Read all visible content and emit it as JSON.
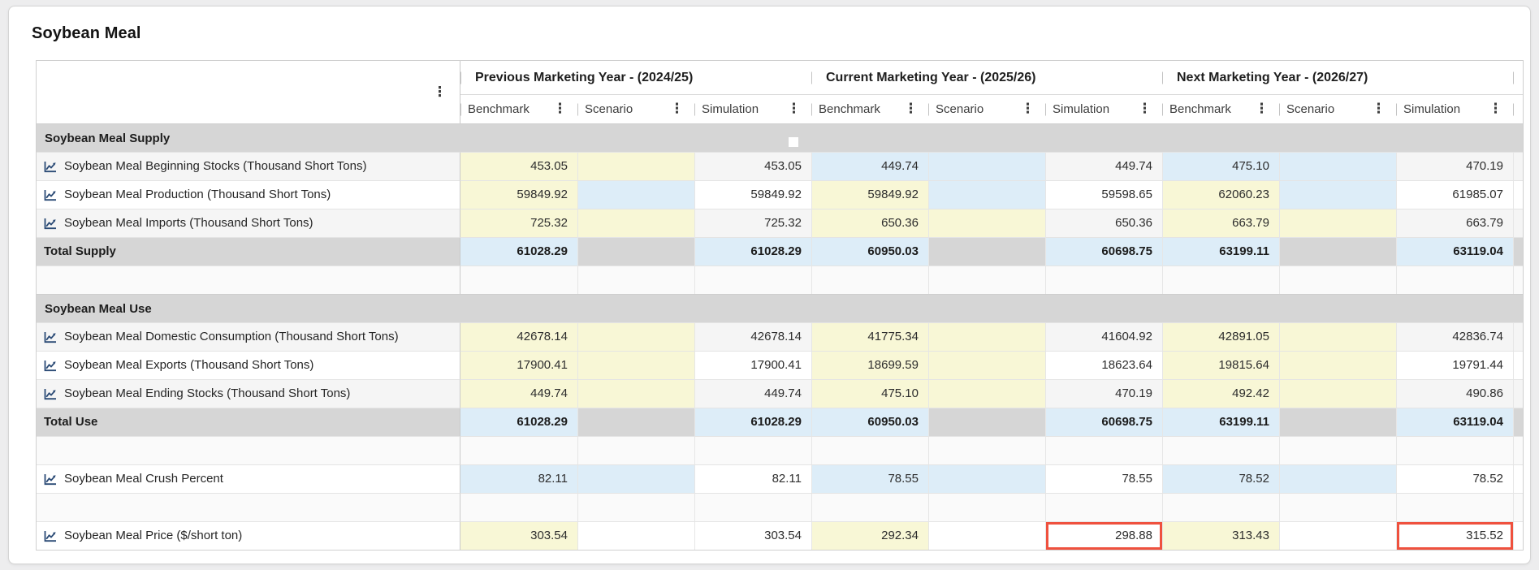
{
  "title": "Soybean Meal",
  "colors": {
    "editable_cell_yellow": "#f8f7d6",
    "linked_cell_blue": "#ddedf8",
    "section_gray": "#d6d6d6",
    "highlight_red": "#ef513e",
    "chart_icon_navy": "#2a4a75"
  },
  "icons": {
    "table_menu": "kebab-menu",
    "column_menu": "kebab-menu",
    "row_chart": "line-chart"
  },
  "table": {
    "year_groups": [
      {
        "label": "Previous Marketing Year - (2024/25)"
      },
      {
        "label": "Current Marketing Year - (2025/26)"
      },
      {
        "label": "Next Marketing Year - (2026/27)"
      }
    ],
    "sub_columns": [
      "Benchmark",
      "Scenario",
      "Simulation"
    ],
    "rows": [
      {
        "type": "section",
        "label": "Soybean Meal Supply"
      },
      {
        "type": "data",
        "striped": true,
        "icon": "line-chart",
        "label": "Soybean Meal Beginning Stocks (Thousand Short Tons)",
        "cells": [
          {
            "v": "453.05",
            "bg": "y"
          },
          {
            "v": "",
            "bg": "y"
          },
          {
            "v": "453.05",
            "bg": ""
          },
          {
            "v": "449.74",
            "bg": "b"
          },
          {
            "v": "",
            "bg": "b"
          },
          {
            "v": "449.74",
            "bg": ""
          },
          {
            "v": "475.10",
            "bg": "b"
          },
          {
            "v": "",
            "bg": "b"
          },
          {
            "v": "470.19",
            "bg": ""
          }
        ]
      },
      {
        "type": "data",
        "striped": false,
        "icon": "line-chart",
        "label": "Soybean Meal Production (Thousand Short Tons)",
        "cells": [
          {
            "v": "59849.92",
            "bg": "y"
          },
          {
            "v": "",
            "bg": "b"
          },
          {
            "v": "59849.92",
            "bg": ""
          },
          {
            "v": "59849.92",
            "bg": "y"
          },
          {
            "v": "",
            "bg": "b"
          },
          {
            "v": "59598.65",
            "bg": ""
          },
          {
            "v": "62060.23",
            "bg": "y"
          },
          {
            "v": "",
            "bg": "b"
          },
          {
            "v": "61985.07",
            "bg": ""
          }
        ]
      },
      {
        "type": "data",
        "striped": true,
        "icon": "line-chart",
        "label": "Soybean Meal Imports (Thousand Short Tons)",
        "cells": [
          {
            "v": "725.32",
            "bg": "y"
          },
          {
            "v": "",
            "bg": "y"
          },
          {
            "v": "725.32",
            "bg": ""
          },
          {
            "v": "650.36",
            "bg": "y"
          },
          {
            "v": "",
            "bg": "y"
          },
          {
            "v": "650.36",
            "bg": ""
          },
          {
            "v": "663.79",
            "bg": "y"
          },
          {
            "v": "",
            "bg": "y"
          },
          {
            "v": "663.79",
            "bg": ""
          }
        ]
      },
      {
        "type": "total",
        "label": "Total Supply",
        "cells": [
          {
            "v": "61028.29",
            "bg": "b"
          },
          {
            "v": "",
            "bg": "g"
          },
          {
            "v": "61028.29",
            "bg": "b"
          },
          {
            "v": "60950.03",
            "bg": "b"
          },
          {
            "v": "",
            "bg": "g"
          },
          {
            "v": "60698.75",
            "bg": "b"
          },
          {
            "v": "63199.11",
            "bg": "b"
          },
          {
            "v": "",
            "bg": "g"
          },
          {
            "v": "63119.04",
            "bg": "b"
          }
        ]
      },
      {
        "type": "spacer"
      },
      {
        "type": "section",
        "label": "Soybean Meal Use"
      },
      {
        "type": "data",
        "striped": true,
        "icon": "line-chart",
        "label": "Soybean Meal Domestic Consumption (Thousand Short Tons)",
        "cells": [
          {
            "v": "42678.14",
            "bg": "y"
          },
          {
            "v": "",
            "bg": "y"
          },
          {
            "v": "42678.14",
            "bg": ""
          },
          {
            "v": "41775.34",
            "bg": "y"
          },
          {
            "v": "",
            "bg": "y"
          },
          {
            "v": "41604.92",
            "bg": ""
          },
          {
            "v": "42891.05",
            "bg": "y"
          },
          {
            "v": "",
            "bg": "y"
          },
          {
            "v": "42836.74",
            "bg": ""
          }
        ]
      },
      {
        "type": "data",
        "striped": false,
        "icon": "line-chart",
        "label": "Soybean Meal Exports (Thousand Short Tons)",
        "cells": [
          {
            "v": "17900.41",
            "bg": "y"
          },
          {
            "v": "",
            "bg": "y"
          },
          {
            "v": "17900.41",
            "bg": ""
          },
          {
            "v": "18699.59",
            "bg": "y"
          },
          {
            "v": "",
            "bg": "y"
          },
          {
            "v": "18623.64",
            "bg": ""
          },
          {
            "v": "19815.64",
            "bg": "y"
          },
          {
            "v": "",
            "bg": "y"
          },
          {
            "v": "19791.44",
            "bg": ""
          }
        ]
      },
      {
        "type": "data",
        "striped": true,
        "icon": "line-chart",
        "label": "Soybean Meal Ending Stocks (Thousand Short Tons)",
        "cells": [
          {
            "v": "449.74",
            "bg": "y"
          },
          {
            "v": "",
            "bg": "y"
          },
          {
            "v": "449.74",
            "bg": ""
          },
          {
            "v": "475.10",
            "bg": "y"
          },
          {
            "v": "",
            "bg": "y"
          },
          {
            "v": "470.19",
            "bg": ""
          },
          {
            "v": "492.42",
            "bg": "y"
          },
          {
            "v": "",
            "bg": "y"
          },
          {
            "v": "490.86",
            "bg": ""
          }
        ]
      },
      {
        "type": "total",
        "label": "Total Use",
        "cells": [
          {
            "v": "61028.29",
            "bg": "b"
          },
          {
            "v": "",
            "bg": "g"
          },
          {
            "v": "61028.29",
            "bg": "b"
          },
          {
            "v": "60950.03",
            "bg": "b"
          },
          {
            "v": "",
            "bg": "g"
          },
          {
            "v": "60698.75",
            "bg": "b"
          },
          {
            "v": "63199.11",
            "bg": "b"
          },
          {
            "v": "",
            "bg": "g"
          },
          {
            "v": "63119.04",
            "bg": "b"
          }
        ]
      },
      {
        "type": "spacer"
      },
      {
        "type": "data",
        "striped": false,
        "icon": "line-chart",
        "label": "Soybean Meal Crush Percent",
        "cells": [
          {
            "v": "82.11",
            "bg": "b"
          },
          {
            "v": "",
            "bg": "b"
          },
          {
            "v": "82.11",
            "bg": ""
          },
          {
            "v": "78.55",
            "bg": "b"
          },
          {
            "v": "",
            "bg": "b"
          },
          {
            "v": "78.55",
            "bg": ""
          },
          {
            "v": "78.52",
            "bg": "b"
          },
          {
            "v": "",
            "bg": "b"
          },
          {
            "v": "78.52",
            "bg": ""
          }
        ]
      },
      {
        "type": "spacer"
      },
      {
        "type": "data",
        "striped": false,
        "icon": "line-chart",
        "label": "Soybean Meal Price ($/short ton)",
        "cells": [
          {
            "v": "303.54",
            "bg": "y"
          },
          {
            "v": "",
            "bg": ""
          },
          {
            "v": "303.54",
            "bg": ""
          },
          {
            "v": "292.34",
            "bg": "y"
          },
          {
            "v": "",
            "bg": ""
          },
          {
            "v": "298.88",
            "bg": "",
            "hl": true
          },
          {
            "v": "313.43",
            "bg": "y"
          },
          {
            "v": "",
            "bg": ""
          },
          {
            "v": "315.52",
            "bg": "",
            "hl": true
          }
        ]
      }
    ]
  }
}
